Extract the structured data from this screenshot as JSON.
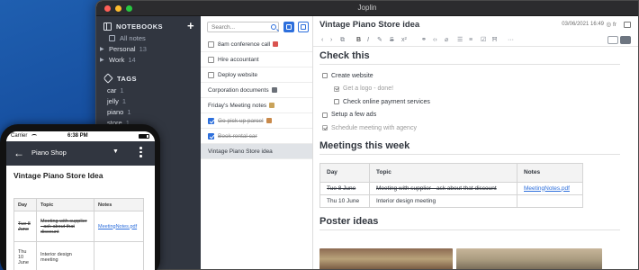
{
  "window": {
    "title": "Joplin"
  },
  "sidebar": {
    "notebooks_header": "NOTEBOOKS",
    "add_label": "+",
    "notebooks": [
      {
        "label": "All notes",
        "count": ""
      },
      {
        "label": "Personal",
        "count": "13"
      },
      {
        "label": "Work",
        "count": "14"
      }
    ],
    "tags_header": "TAGS",
    "tags": [
      {
        "label": "car",
        "count": "1"
      },
      {
        "label": "jelly",
        "count": "1"
      },
      {
        "label": "piano",
        "count": "1"
      },
      {
        "label": "store",
        "count": "1"
      }
    ]
  },
  "notelist": {
    "search_placeholder": "Search...",
    "notes": [
      {
        "title": "8am conference call",
        "todo": true,
        "done": false
      },
      {
        "title": "Hire accountant",
        "todo": true,
        "done": false
      },
      {
        "title": "Deploy website",
        "todo": true,
        "done": false
      },
      {
        "title": "Corporation documents",
        "todo": false,
        "done": false
      },
      {
        "title": "Friday's Meeting notes",
        "todo": false,
        "done": false
      },
      {
        "title": "Go pick up parcel",
        "todo": true,
        "done": true
      },
      {
        "title": "Book rental car",
        "todo": true,
        "done": true
      },
      {
        "title": "Vintage Piano Store idea",
        "todo": false,
        "done": false,
        "selected": true
      }
    ]
  },
  "editor": {
    "title": "Vintage Piano Store idea",
    "date": "03/06/2021 16:49",
    "lang": "fr",
    "section1": "Check this",
    "todos": [
      {
        "label": "Create website",
        "done": false,
        "indent": 0
      },
      {
        "label": "Get a logo - done!",
        "done": true,
        "indent": 1
      },
      {
        "label": "Check online payment services",
        "done": false,
        "indent": 1
      },
      {
        "label": "Setup a few ads",
        "done": false,
        "indent": 0
      },
      {
        "label": "Schedule meeting with agency",
        "done": true,
        "indent": 0
      }
    ],
    "section2": "Meetings this week",
    "table": {
      "headers": [
        "Day",
        "Topic",
        "Notes"
      ],
      "rows": [
        [
          "Tue 8 June",
          "Meeting with supplier - ask about that discount",
          "MeetingNotes.pdf"
        ],
        [
          "Thu 10 June",
          "Interior design meeting",
          ""
        ]
      ]
    },
    "section3": "Poster ideas"
  },
  "phone": {
    "carrier": "Carrier",
    "time": "6:38 PM",
    "notebook": "Piano Shop",
    "note_title": "Vintage Piano Store Idea",
    "table": {
      "headers": [
        "Day",
        "Topic",
        "Notes"
      ],
      "rows": [
        [
          "Tue 8 June",
          "Meeting with supplier - ask about that discount",
          "MeetingNotes.pdf"
        ],
        [
          "Thu 10 June",
          "Interior design meeting",
          ""
        ]
      ]
    }
  }
}
